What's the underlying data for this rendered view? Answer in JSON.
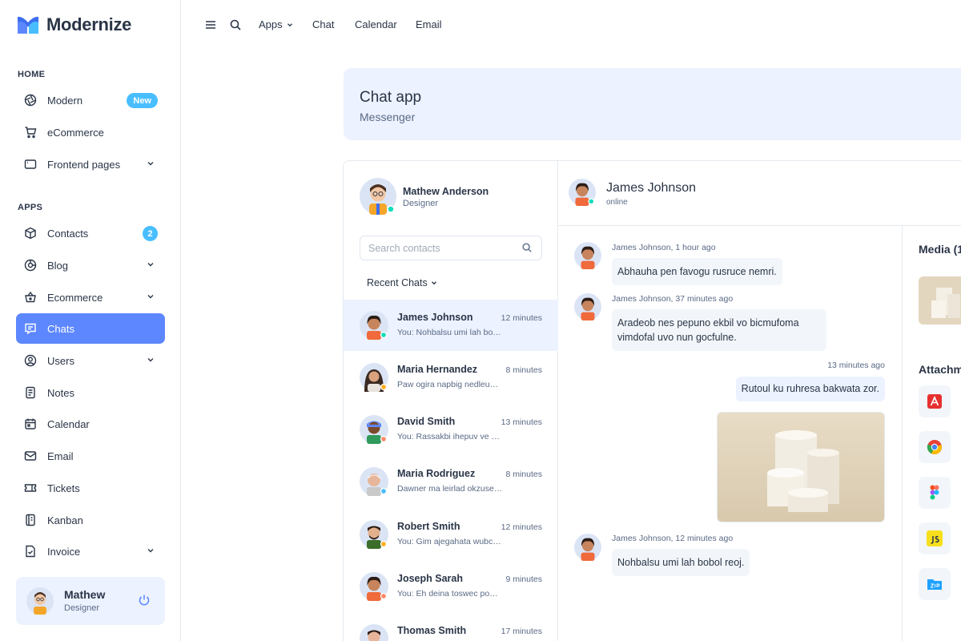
{
  "brand": {
    "name": "Modernize"
  },
  "sidebar": {
    "sections": {
      "home": "HOME",
      "apps": "APPS"
    },
    "items": [
      {
        "label": "Modern",
        "badge": "New"
      },
      {
        "label": "eCommerce"
      },
      {
        "label": "Frontend pages"
      },
      {
        "label": "Contacts",
        "badge": "2"
      },
      {
        "label": "Blog"
      },
      {
        "label": "Ecommerce"
      },
      {
        "label": "Chats"
      },
      {
        "label": "Users"
      },
      {
        "label": "Notes"
      },
      {
        "label": "Calendar"
      },
      {
        "label": "Email"
      },
      {
        "label": "Tickets"
      },
      {
        "label": "Kanban"
      },
      {
        "label": "Invoice"
      }
    ],
    "profile": {
      "name": "Mathew",
      "role": "Designer"
    }
  },
  "topbar": {
    "links": [
      "Apps",
      "Chat",
      "Calendar",
      "Email"
    ]
  },
  "banner": {
    "title": "Chat app",
    "subtitle": "Messenger"
  },
  "contacts": {
    "me": {
      "name": "Mathew Anderson",
      "role": "Designer"
    },
    "search_placeholder": "Search contacts",
    "recent_label": "Recent Chats",
    "list": [
      {
        "name": "James Johnson",
        "time": "12 minutes",
        "msg": "You: Nohbalsu umi lah bobol reoj.",
        "status": "#13deb9"
      },
      {
        "name": "Maria Hernandez",
        "time": "8 minutes",
        "msg": "Paw ogira napbig nedleum ukbob.",
        "status": "#ffae1f"
      },
      {
        "name": "David Smith",
        "time": "13 minutes",
        "msg": "You: Rassakbi ihepuv ve dimbo nu.",
        "status": "#fa896b"
      },
      {
        "name": "Maria Rodriguez",
        "time": "8 minutes",
        "msg": "Dawner ma leirlad okzused ipsum.",
        "status": "#49beff"
      },
      {
        "name": "Robert Smith",
        "time": "12 minutes",
        "msg": "You: Gim ajegahata wubcofe sumo.",
        "status": "#ffae1f"
      },
      {
        "name": "Joseph Sarah",
        "time": "9 minutes",
        "msg": "You: Eh deina toswec powum luro.",
        "status": "#fa896b"
      },
      {
        "name": "Thomas Smith",
        "time": "17 minutes",
        "msg": "",
        "status": "#13deb9"
      }
    ]
  },
  "conversation": {
    "name": "James Johnson",
    "status": "online",
    "messages": [
      {
        "meta": "James Johnson, 1 hour ago",
        "text": "Abhauha pen favogu rusruce nemri."
      },
      {
        "meta": "James Johnson, 37 minutes ago",
        "text": "Aradeob nes pepuno ekbil vo bicmufoma vimdofal uvo nun gocfulne."
      },
      {
        "meta": "13 minutes ago",
        "text": "Rutoul ku ruhresa bakwata zor."
      },
      {
        "meta": "James Johnson, 12 minutes ago",
        "text": "Nohbalsu umi lah bobol reoj."
      }
    ]
  },
  "media": {
    "media_title": "Media (1",
    "attach_title": "Attachm"
  },
  "colors": {
    "primary": "#5d87ff",
    "secondary": "#49beff",
    "light_primary": "#ecf2ff",
    "text": "#2a3547"
  }
}
